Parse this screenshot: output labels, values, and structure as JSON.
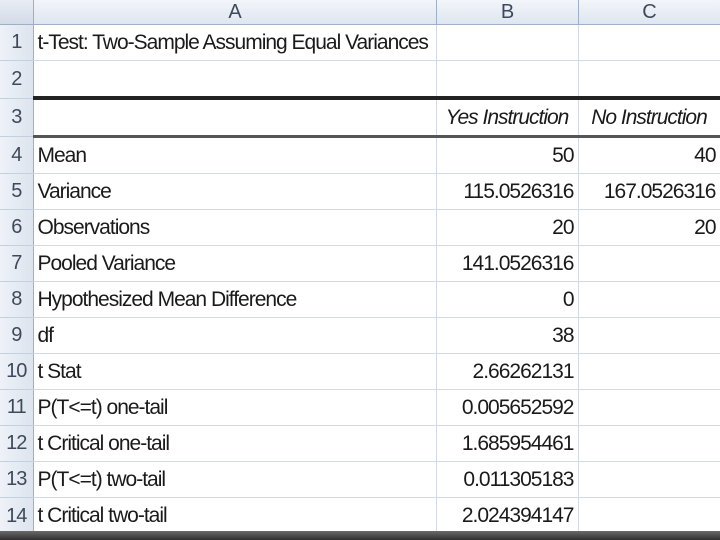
{
  "columns": [
    "A",
    "B",
    "C"
  ],
  "rows": [
    {
      "num": "1",
      "a": "t-Test: Two-Sample Assuming Equal Variances",
      "b": "",
      "c": ""
    },
    {
      "num": "2",
      "a": "",
      "b": "",
      "c": ""
    },
    {
      "num": "3",
      "a": "",
      "b": "Yes Instruction",
      "c": "No Instruction"
    },
    {
      "num": "4",
      "a": "Mean",
      "b": "50",
      "c": "40"
    },
    {
      "num": "5",
      "a": "Variance",
      "b": "115.0526316",
      "c": "167.0526316"
    },
    {
      "num": "6",
      "a": "Observations",
      "b": "20",
      "c": "20"
    },
    {
      "num": "7",
      "a": "Pooled Variance",
      "b": "141.0526316",
      "c": ""
    },
    {
      "num": "8",
      "a": "Hypothesized Mean Difference",
      "b": "0",
      "c": ""
    },
    {
      "num": "9",
      "a": "df",
      "b": "38",
      "c": ""
    },
    {
      "num": "10",
      "a": "t Stat",
      "b": "2.66262131",
      "c": ""
    },
    {
      "num": "11",
      "a": "P(T<=t) one-tail",
      "b": "0.005652592",
      "c": ""
    },
    {
      "num": "12",
      "a": "t Critical one-tail",
      "b": "1.685954461",
      "c": ""
    },
    {
      "num": "13",
      "a": "P(T<=t) two-tail",
      "b": "0.011305183",
      "c": ""
    },
    {
      "num": "14",
      "a": "t Critical two-tail",
      "b": "2.024394147",
      "c": ""
    }
  ]
}
